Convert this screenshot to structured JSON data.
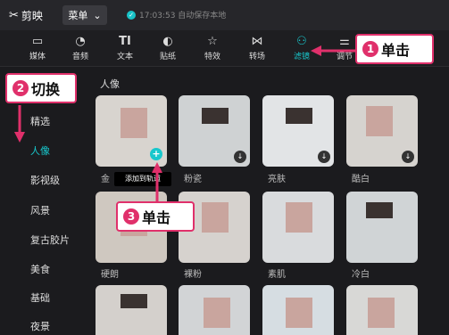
{
  "app": {
    "logo_text": "剪映",
    "menu_label": "菜单",
    "save_status": "17:03:53 自动保存本地"
  },
  "toolbar": {
    "items": [
      {
        "label": "媒体",
        "icon": "media-icon"
      },
      {
        "label": "音频",
        "icon": "audio-icon"
      },
      {
        "label": "文本",
        "icon": "text-icon"
      },
      {
        "label": "贴纸",
        "icon": "sticker-icon"
      },
      {
        "label": "特效",
        "icon": "effects-icon"
      },
      {
        "label": "转场",
        "icon": "transition-icon"
      },
      {
        "label": "滤镜",
        "icon": "filter-icon",
        "active": true
      },
      {
        "label": "调节",
        "icon": "adjust-icon"
      }
    ]
  },
  "sidebar": {
    "items": [
      {
        "label": "精选"
      },
      {
        "label": "人像",
        "active": true
      },
      {
        "label": "影视级"
      },
      {
        "label": "风景"
      },
      {
        "label": "复古胶片"
      },
      {
        "label": "美食"
      },
      {
        "label": "基础"
      },
      {
        "label": "夜景"
      }
    ]
  },
  "main": {
    "section_title": "人像",
    "tooltip": "添加到轨道",
    "thumbnails": [
      {
        "label": "金"
      },
      {
        "label": "粉瓷"
      },
      {
        "label": "亮肤"
      },
      {
        "label": "酷白"
      },
      {
        "label": "硬朗"
      },
      {
        "label": "裸粉"
      },
      {
        "label": "素肌"
      },
      {
        "label": "冷白"
      },
      {
        "label": ""
      },
      {
        "label": ""
      },
      {
        "label": ""
      },
      {
        "label": ""
      }
    ]
  },
  "callouts": {
    "c1": {
      "num": "1",
      "text": "单击"
    },
    "c2": {
      "num": "2",
      "text": "切换"
    },
    "c3": {
      "num": "3",
      "text": "单击"
    }
  },
  "colors": {
    "accent": "#18c7cc",
    "callout": "#e0306b"
  }
}
